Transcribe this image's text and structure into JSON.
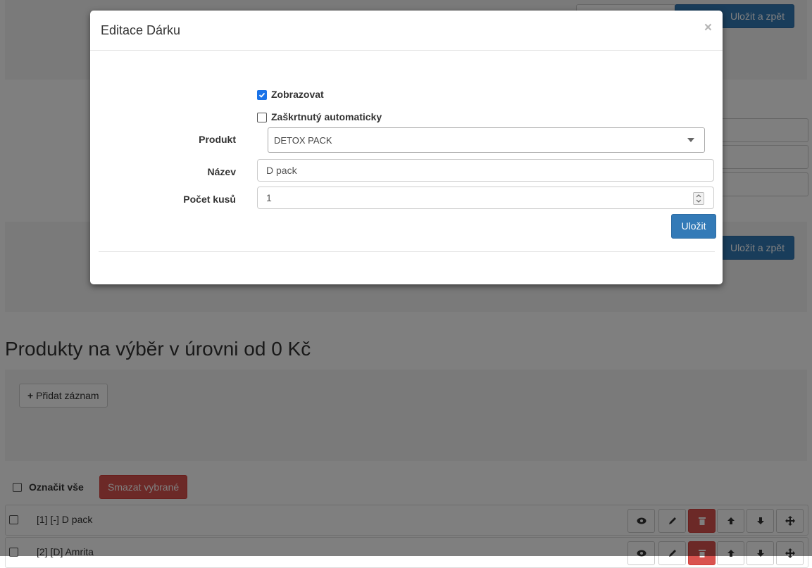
{
  "background": {
    "top_buttons": {
      "save_back_label": "Uložit a zpět"
    },
    "middle_buttons": {
      "save_back_label": "Uložit a zpět"
    },
    "section_title": "Produkty na výběr v úrovni od 0 Kč",
    "add_record_label": "Přidat záznam",
    "check_all_label": "Označit vše",
    "delete_selected_label": "Smazat vybrané",
    "rows": [
      {
        "label": "[1] [-] D pack"
      },
      {
        "label": "[2] [D] Amrita"
      }
    ]
  },
  "modal": {
    "title": "Editace Dárku",
    "close_label": "×",
    "show_checkbox": {
      "label": "Zobrazovat",
      "checked": true
    },
    "auto_checkbox": {
      "label": "Zaškrtnutý automaticky",
      "checked": false
    },
    "product": {
      "label": "Produkt",
      "value": "DETOX PACK"
    },
    "name": {
      "label": "Název",
      "value": "D pack"
    },
    "quantity": {
      "label": "Počet kusů",
      "value": "1"
    },
    "save_label": "Uložit"
  },
  "colors": {
    "primary": "#337ab7",
    "danger": "#d9534f",
    "checkbox_accent": "#1a73e8"
  },
  "icons": [
    "plus-icon",
    "eye-icon",
    "pencil-icon",
    "trash-icon",
    "arrow-up-icon",
    "arrow-down-icon",
    "move-icon",
    "caret-down-icon",
    "spinner-icon"
  ]
}
